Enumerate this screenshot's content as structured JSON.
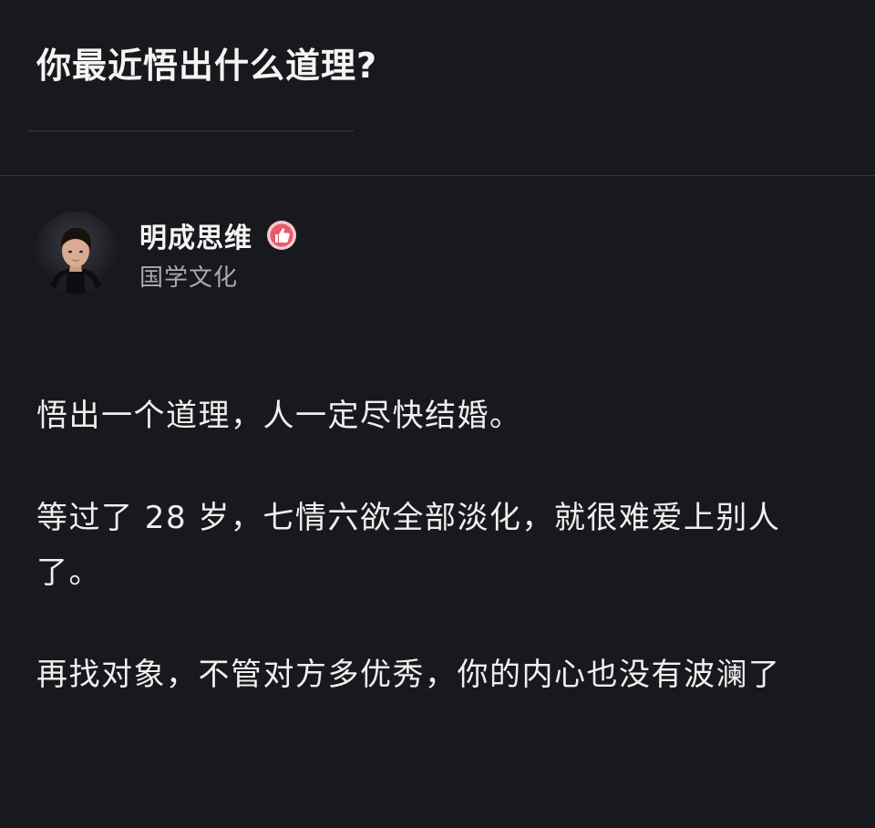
{
  "question": {
    "title": "你最近悟出什么道理?"
  },
  "author": {
    "name": "明成思维",
    "tag": "国学文化",
    "verified_icon": "thumbs-up-badge-icon",
    "badge_color": "#e85a6a"
  },
  "answer": {
    "paragraphs": [
      "悟出一个道理，人一定尽快结婚。",
      "等过了 28 岁，七情六欲全部淡化，就很难爱上别人了。",
      "再找对象，不管对方多优秀，你的内心也没有波澜了"
    ]
  },
  "colors": {
    "background": "#17191d",
    "text": "#efefef",
    "secondary_text": "#a9abb0"
  }
}
